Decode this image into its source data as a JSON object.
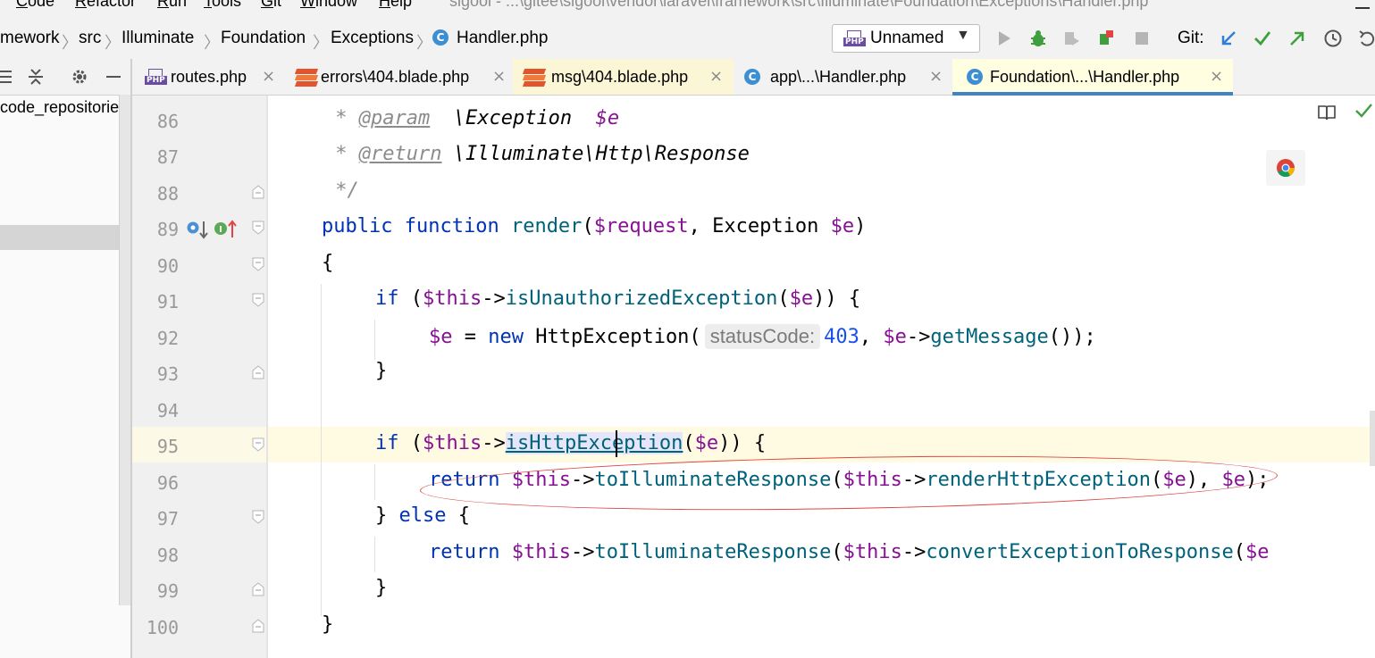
{
  "menu": {
    "items": [
      "Code",
      "Refactor",
      "Run",
      "Tools",
      "Git",
      "Window",
      "Help"
    ],
    "window_title": "sigool - ...\\gitee\\sigool\\vendor\\laravel\\framework\\src\\Illuminate\\Foundation\\Exceptions\\Handler.php"
  },
  "breadcrumb": {
    "items": [
      "mework",
      "src",
      "Illuminate",
      "Foundation",
      "Exceptions"
    ],
    "file": "Handler.php",
    "file_icon_letter": "C"
  },
  "toolbar": {
    "run_config_label": "Unnamed",
    "run_config_icon_text": "PHP",
    "git_label": "Git:"
  },
  "project_panel": {
    "tree_item": "code_repositories"
  },
  "tabs": [
    {
      "label": "routes.php",
      "icon": "php-file-icon",
      "close": "×"
    },
    {
      "label": "errors\\404.blade.php",
      "icon": "blade-file-icon",
      "close": "×"
    },
    {
      "label": "msg\\404.blade.php",
      "icon": "blade-file-icon",
      "close": "×"
    },
    {
      "label": "app\\...\\Handler.php",
      "icon": "class-icon",
      "close": "×"
    },
    {
      "label": "Foundation\\...\\Handler.php",
      "icon": "class-icon",
      "close": "×",
      "active": true
    }
  ],
  "gutter": {
    "line_numbers": [
      "86",
      "87",
      "88",
      "89",
      "90",
      "91",
      "92",
      "93",
      "94",
      "95",
      "96",
      "97",
      "98",
      "99",
      "100"
    ],
    "override_marker_letter": "I"
  },
  "code": {
    "l86_star": " * ",
    "l86_tag": "@param",
    "l86_rest": "  \\Exception  ",
    "l86_var": "$e",
    "l87_star": " * ",
    "l87_tag": "@return",
    "l87_rest": " \\Illuminate\\Http\\Response",
    "l88": " */",
    "l89_public": "public",
    "l89_function": "function",
    "l89_name": "render",
    "l89_open": "(",
    "l89_req": "$request",
    "l89_mid": ", Exception ",
    "l89_e": "$e",
    "l89_close": ")",
    "l90": "{",
    "l91_if": "if",
    "l91_open": " (",
    "l91_this": "$this",
    "l91_arrow": "->",
    "l91_fn": "isUnauthorizedException",
    "l91_paren": "(",
    "l91_e": "$e",
    "l91_end": ")) {",
    "l92_e": "$e",
    "l92_eq": " = ",
    "l92_new": "new",
    "l92_cls": " HttpException(",
    "l92_hint": "statusCode:",
    "l92_num": "403",
    "l92_comma": ", ",
    "l92_e2": "$e",
    "l92_arrow": "->",
    "l92_fn": "getMessage",
    "l92_end": "());",
    "l93": "}",
    "l95_if": "if",
    "l95_open": " (",
    "l95_this": "$this",
    "l95_arrow": "->",
    "l95_fn": "isHttpException",
    "l95_paren": "(",
    "l95_e": "$e",
    "l95_end": ")) {",
    "l96_return": "return",
    "l96_sp": " ",
    "l96_this": "$this",
    "l96_arrow": "->",
    "l96_fn": "toIlluminateResponse",
    "l96_paren": "(",
    "l96_this2": "$this",
    "l96_arrow2": "->",
    "l96_fn2": "renderHttpException",
    "l96_paren2": "(",
    "l96_e": "$e",
    "l96_mid": "), ",
    "l96_e2": "$e",
    "l96_end": ");",
    "l97_close": "} ",
    "l97_else": "else",
    "l97_open": " {",
    "l98_return": "return",
    "l98_sp": " ",
    "l98_this": "$this",
    "l98_arrow": "->",
    "l98_fn": "toIlluminateResponse",
    "l98_paren": "(",
    "l98_this2": "$this",
    "l98_arrow2": "->",
    "l98_fn2": "convertExceptionToResponse",
    "l98_paren2": "(",
    "l98_e": "$e",
    "l99": "}",
    "l100": "}"
  },
  "colors": {
    "keyword": "#0033b3",
    "variable": "#871094",
    "function": "#00627a",
    "number": "#1750eb",
    "annotation_circle": "#e04545",
    "active_tab_underline": "#4083c9"
  }
}
